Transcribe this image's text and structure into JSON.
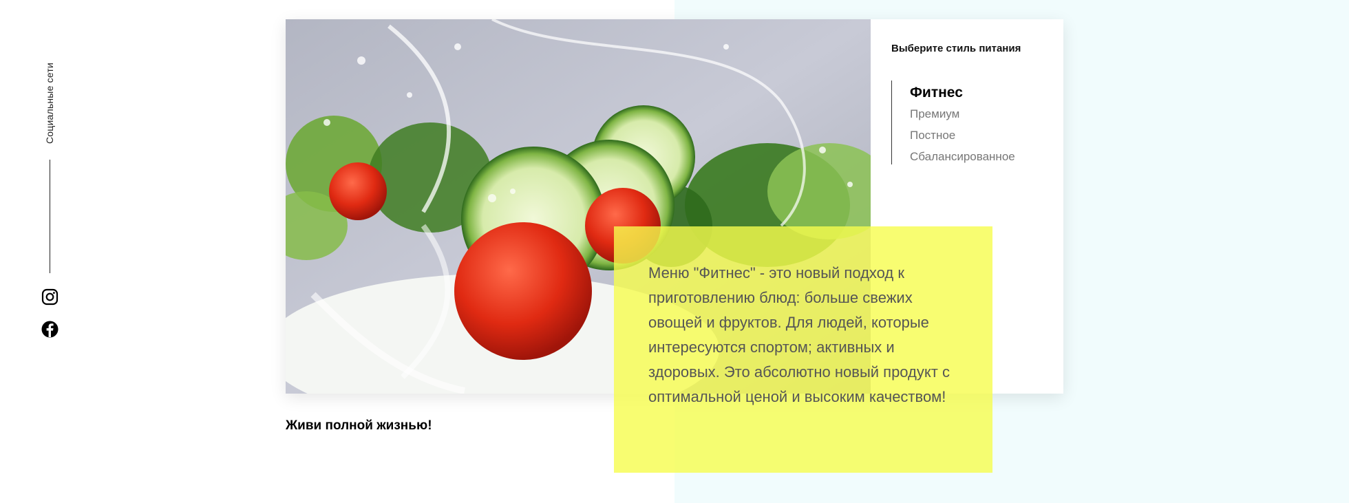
{
  "social": {
    "label": "Социальные сети",
    "icons": [
      "instagram-icon",
      "facebook-icon"
    ]
  },
  "menu": {
    "title": "Выберите стиль питания",
    "items": [
      {
        "label": "Фитнес",
        "active": true
      },
      {
        "label": "Премиум",
        "active": false
      },
      {
        "label": "Постное",
        "active": false
      },
      {
        "label": "Сбалансированное",
        "active": false
      }
    ]
  },
  "description": "Меню \"Фитнес\" - это новый подход к приготовлению блюд: больше свежих овощей и фруктов. Для людей, которые интересуются спортом; активных и здоровых. Это абсолютно новый продукт с оптимальной ценой и высоким качеством!",
  "tagline": "Живи полной жизнью!",
  "colors": {
    "highlight": "#f6fd4d",
    "background_right": "#f1fcfd"
  }
}
